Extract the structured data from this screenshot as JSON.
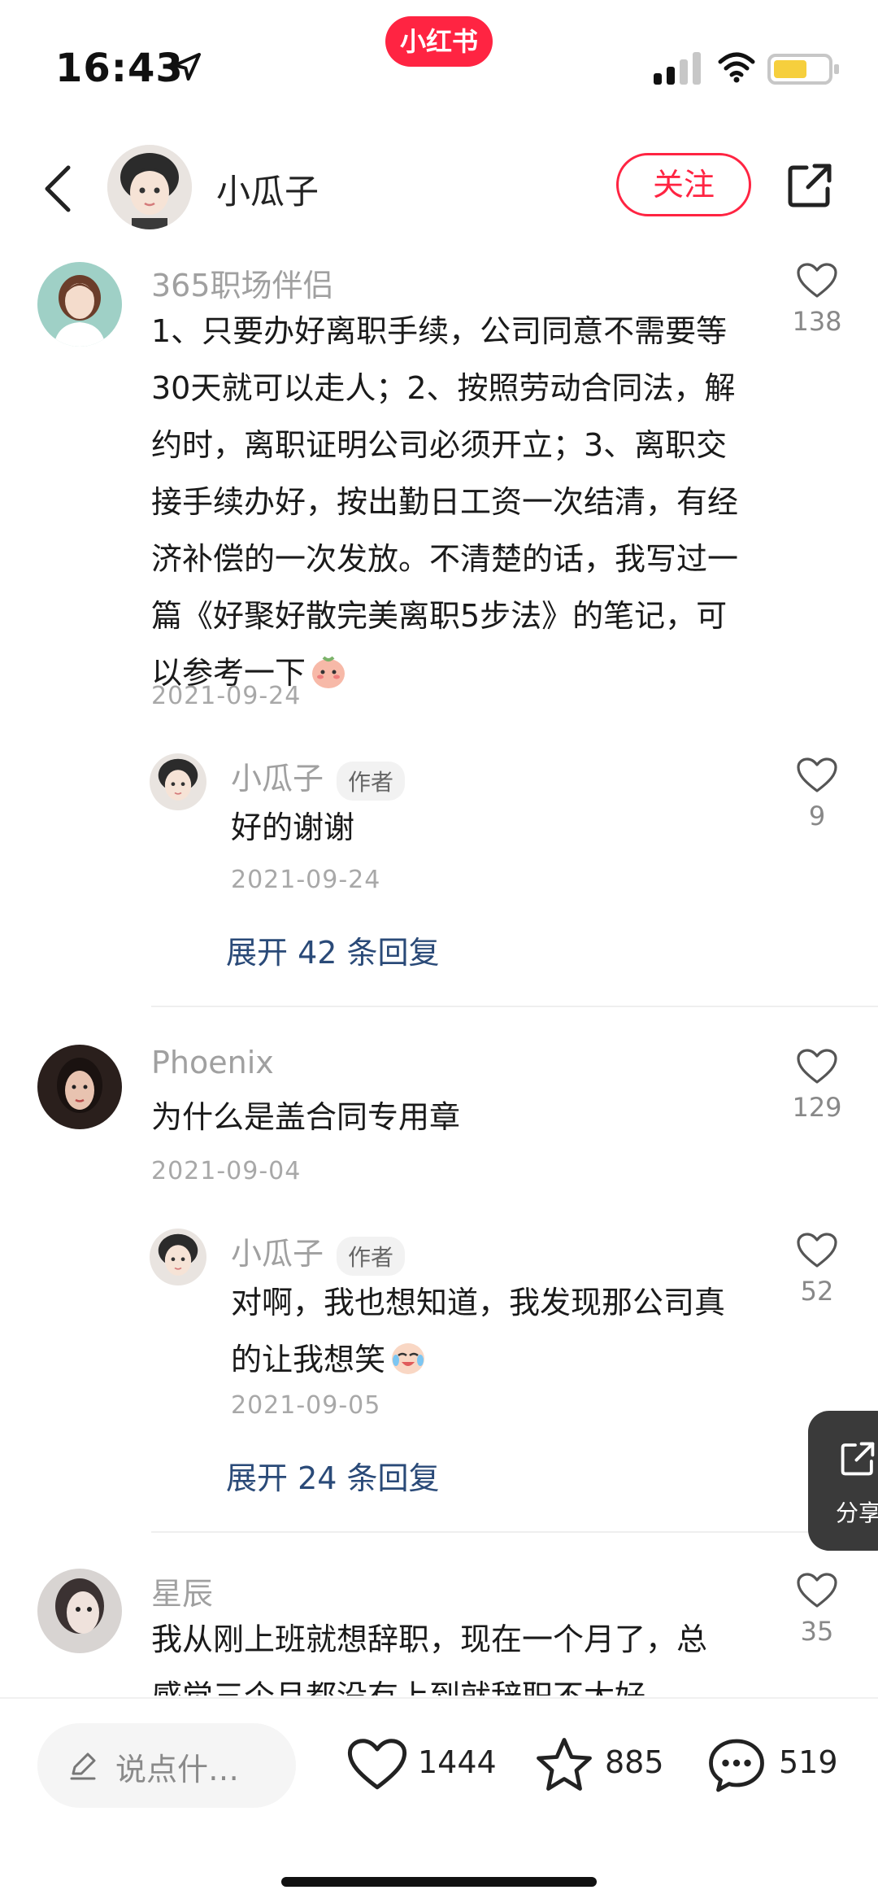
{
  "status_bar": {
    "time": "16:43",
    "app_badge": "小红书"
  },
  "header": {
    "author_name": "小瓜子",
    "follow_label": "关注"
  },
  "author_tag": "作者",
  "comments": [
    {
      "user": "365职场伴侣",
      "text": "1、只要办好离职手续，公司同意不需要等30天就可以走人；2、按照劳动合同法，解约时，离职证明公司必须开立；3、离职交接手续办好，按出勤日工资一次结清，有经济补偿的一次发放。不清楚的话，我写过一篇《好聚好散完美离职5步法》的笔记，可以参考一下",
      "date": "2021-09-24",
      "likes": "138",
      "reply": {
        "user": "小瓜子",
        "text": "好的谢谢",
        "date": "2021-09-24",
        "likes": "9"
      },
      "expand": "展开 42 条回复"
    },
    {
      "user": "Phoenix",
      "text": "为什么是盖合同专用章",
      "date": "2021-09-04",
      "likes": "129",
      "reply": {
        "user": "小瓜子",
        "text": "对啊，我也想知道，我发现那公司真的让我想笑",
        "date": "2021-09-05",
        "likes": "52"
      },
      "expand": "展开 24 条回复"
    },
    {
      "user": "星辰",
      "text": "我从刚上班就想辞职，现在一个月了，总感觉三个月都没有上到就辞职不太好",
      "likes": "35"
    }
  ],
  "float_share": {
    "label": "分享"
  },
  "bottom_bar": {
    "input_placeholder": "说点什…",
    "likes": "1444",
    "collects": "885",
    "comments": "519"
  }
}
